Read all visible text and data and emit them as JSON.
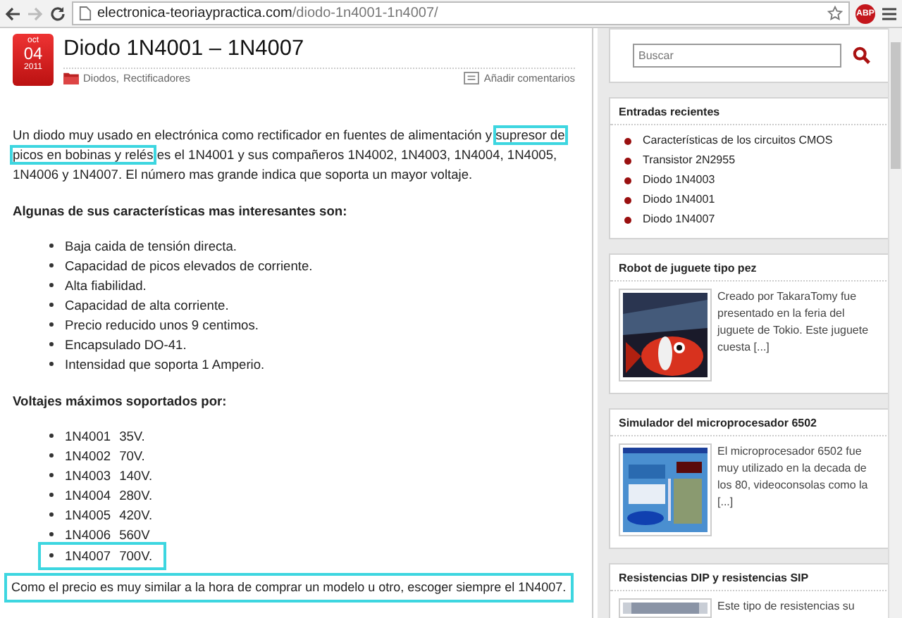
{
  "browser": {
    "url_host": "electronica-teoriaypractica.com",
    "url_path": "/diodo-1n4001-1n4007/",
    "badge": "ABP"
  },
  "post": {
    "date": {
      "month": "oct",
      "day": "04",
      "year": "2011"
    },
    "title": "Diodo 1N4001 – 1N4007",
    "categories": [
      "Diodos",
      "Rectificadores"
    ],
    "category_separator": ",",
    "comments": "Añadir comentarios",
    "intro": [
      {
        "text": "Un diodo muy usado en electrónica como rectificador en fuentes de alimentación y ",
        "highlighted": false
      },
      {
        "text": "supresor de picos en bobinas y relés",
        "highlighted": true
      },
      {
        "text": " es el 1N4001 y sus compañeros 1N4002, 1N4003, 1N4004, 1N4005, 1N4006 y 1N4007. El número mas grande indica que soporta un mayor voltaje.",
        "highlighted": false
      }
    ],
    "features_heading": "Algunas de sus características mas interesantes son:",
    "features": [
      "Baja caida de tensión directa.",
      "Capacidad de picos elevados de corriente.",
      "Alta fiabilidad.",
      "Capacidad de alta corriente.",
      "Precio reducido unos 9 centimos.",
      "Encapsulado DO-41.",
      "Intensidad que soporta 1 Amperio."
    ],
    "voltages_heading": "Voltajes máximos soportados por:",
    "voltages": [
      {
        "model": "1N4001",
        "voltage": "35V.",
        "highlighted": false
      },
      {
        "model": "1N4002",
        "voltage": "70V.",
        "highlighted": false
      },
      {
        "model": "1N4003",
        "voltage": "140V.",
        "highlighted": false
      },
      {
        "model": "1N4004",
        "voltage": "280V.",
        "highlighted": false
      },
      {
        "model": "1N4005",
        "voltage": "420V.",
        "highlighted": false
      },
      {
        "model": "1N4006",
        "voltage": "560V",
        "highlighted": false
      },
      {
        "model": "1N4007",
        "voltage": "700V.",
        "highlighted": true
      }
    ],
    "conclusion": {
      "text": "Como el precio es muy similar a la hora de comprar un modelo u otro, escoger siempre el 1N4007.",
      "highlighted": true
    }
  },
  "sidebar": {
    "search": {
      "placeholder": "Buscar"
    },
    "recent": {
      "title": "Entradas recientes",
      "items": [
        "Características de los circuitos CMOS",
        "Transistor 2N2955",
        "Diodo 1N4003",
        "Diodo 1N4001",
        "Diodo 1N4007"
      ]
    },
    "features": [
      {
        "title": "Robot de juguete tipo pez",
        "excerpt": "Creado por TakaraTomy fue presentado en la feria del juguete de Tokio. Este juguete cuesta [...]",
        "kind": "picture"
      },
      {
        "title": "Simulador del microprocesador 6502",
        "excerpt": "El microprocesador 6502 fue muy utilizado en la decada de los 80, videoconsolas como la [...]",
        "kind": "picture"
      },
      {
        "title": "Resistencias DIP y resistencias SIP",
        "excerpt": "Este tipo de resistencias su",
        "kind": "picture"
      }
    ]
  }
}
